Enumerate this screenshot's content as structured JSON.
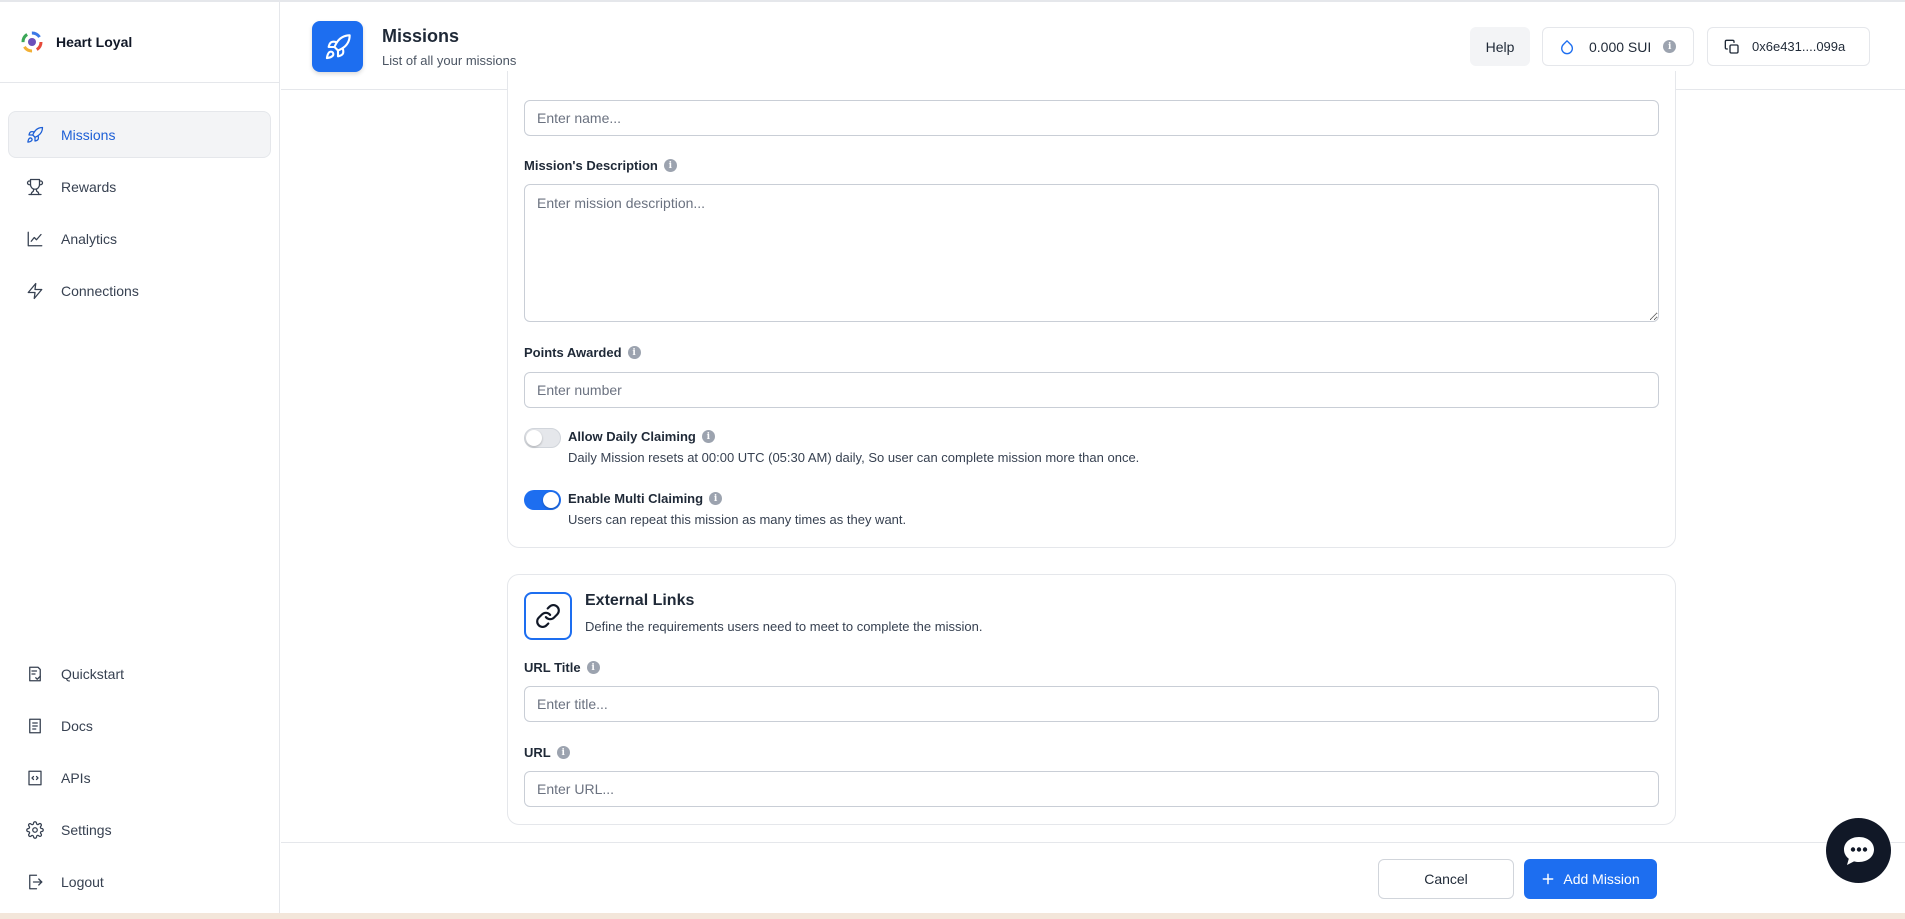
{
  "app": {
    "name": "Heart Loyal"
  },
  "sidebar": {
    "items": [
      {
        "label": "Missions",
        "icon": "rocket-icon",
        "active": true
      },
      {
        "label": "Rewards",
        "icon": "trophy-icon"
      },
      {
        "label": "Analytics",
        "icon": "chart-line-icon"
      },
      {
        "label": "Connections",
        "icon": "lightning-icon"
      }
    ],
    "bottom_items": [
      {
        "label": "Quickstart",
        "icon": "quickstart-icon"
      },
      {
        "label": "Docs",
        "icon": "document-icon"
      },
      {
        "label": "APIs",
        "icon": "code-icon"
      },
      {
        "label": "Settings",
        "icon": "gear-icon"
      },
      {
        "label": "Logout",
        "icon": "logout-icon"
      }
    ]
  },
  "header": {
    "title": "Missions",
    "subtitle": "List of all your missions",
    "help_label": "Help",
    "balance": "0.000 SUI",
    "wallet": "0x6e431....099a"
  },
  "form": {
    "name_placeholder": "Enter name...",
    "description_label": "Mission's Description",
    "description_placeholder": "Enter mission description...",
    "points_label": "Points Awarded",
    "points_placeholder": "Enter number",
    "daily_title": "Allow Daily Claiming",
    "daily_desc": "Daily Mission resets at 00:00 UTC (05:30 AM) daily, So user can complete mission more than once.",
    "daily_enabled": false,
    "multi_title": "Enable Multi Claiming",
    "multi_desc": "Users can repeat this mission as many times as they want.",
    "multi_enabled": true
  },
  "external_links": {
    "title": "External Links",
    "subtitle": "Define the requirements users need to meet to complete the mission.",
    "url_title_label": "URL Title",
    "url_title_placeholder": "Enter title...",
    "url_label": "URL",
    "url_placeholder": "Enter URL..."
  },
  "footer": {
    "cancel_label": "Cancel",
    "add_label": "Add Mission"
  },
  "colors": {
    "accent": "#1d6ef0",
    "active_nav_text": "#1d5fd6",
    "chat_button": "#111827"
  }
}
